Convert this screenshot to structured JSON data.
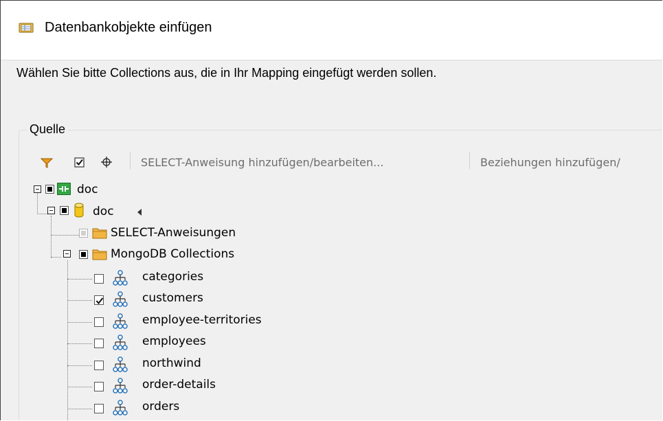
{
  "window": {
    "title": "Datenbankobjekte einfügen"
  },
  "instruction": "Wählen Sie bitte Collections aus, die in Ihr Mapping eingefügt werden sollen.",
  "source_group": {
    "label": "Quelle",
    "toolbar": {
      "filter_icon": "filter-icon",
      "select_all_icon": "checkbox-icon",
      "locate_icon": "crosshair-icon",
      "select_statement_button": "SELECT-Anweisung hinzufügen/bearbeiten...",
      "relations_button": "Beziehungen hinzufügen/"
    }
  },
  "tree": {
    "root": {
      "label": "doc",
      "icon": "database-connection-icon",
      "state": "partial",
      "expanded": true
    },
    "database": {
      "label": "doc",
      "icon": "database-cylinder-icon",
      "state": "partial",
      "expanded": true
    },
    "select_folder": {
      "label": "SELECT-Anweisungen",
      "icon": "folder-icon",
      "state": "disabled"
    },
    "collections_folder": {
      "label": "MongoDB Collections",
      "icon": "folder-icon",
      "state": "partial",
      "expanded": true
    },
    "collections": [
      {
        "label": "categories",
        "checked": false
      },
      {
        "label": "customers",
        "checked": true
      },
      {
        "label": "employee-territories",
        "checked": false
      },
      {
        "label": "employees",
        "checked": false
      },
      {
        "label": "northwind",
        "checked": false
      },
      {
        "label": "order-details",
        "checked": false
      },
      {
        "label": "orders",
        "checked": false
      }
    ]
  },
  "colors": {
    "folder": "#f2b544",
    "connection_icon": "#2e9e3e",
    "database_icon": "#f5c518",
    "hierarchy_icon": "#2b73b8",
    "filter": "#e89b1c"
  }
}
